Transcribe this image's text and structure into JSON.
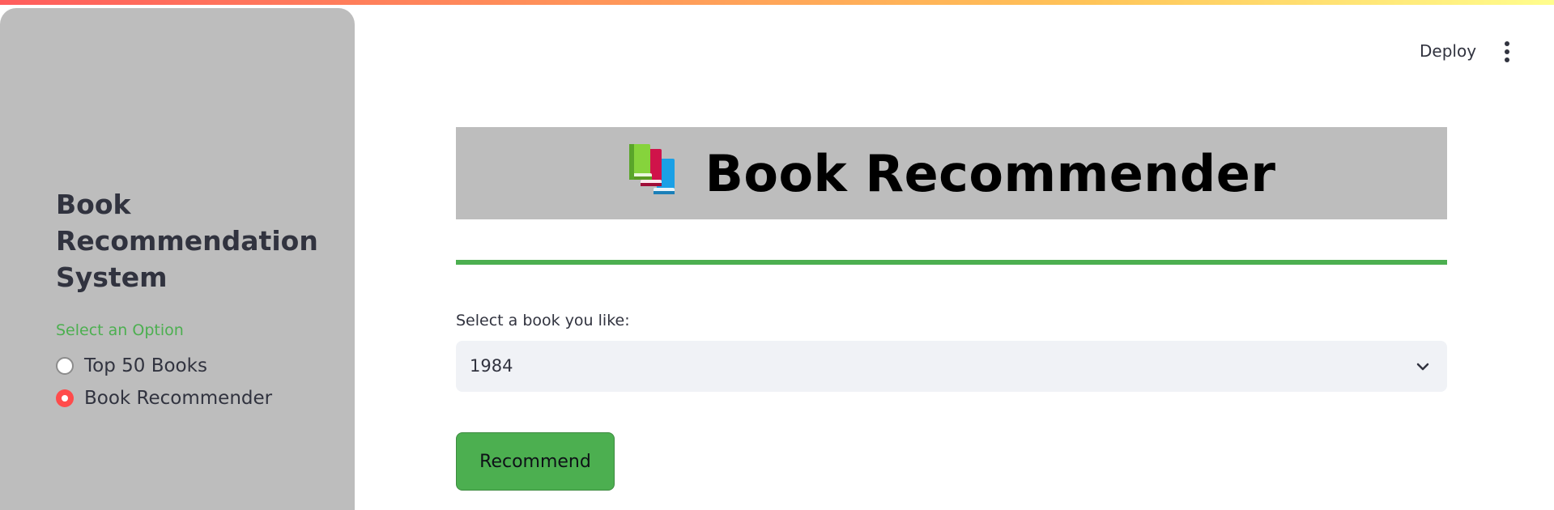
{
  "header": {
    "deploy_label": "Deploy",
    "menu_icon": "kebab-vertical-icon"
  },
  "sidebar": {
    "title": "Book Recommendation System",
    "option_label": "Select an Option",
    "options": [
      {
        "label": "Top 50 Books",
        "selected": false
      },
      {
        "label": "Book Recommender",
        "selected": true
      }
    ]
  },
  "main": {
    "banner": {
      "icon": "books-icon",
      "title": "Book Recommender"
    },
    "select": {
      "label": "Select a book you like:",
      "value": "1984",
      "icon": "chevron-down-icon"
    },
    "recommend_label": "Recommend"
  },
  "colors": {
    "sidebar_bg": "#bdbdbd",
    "accent_green": "#4caf50",
    "radio_selected": "#ff4b4b",
    "select_bg": "#f0f2f6",
    "text": "#31333f"
  }
}
